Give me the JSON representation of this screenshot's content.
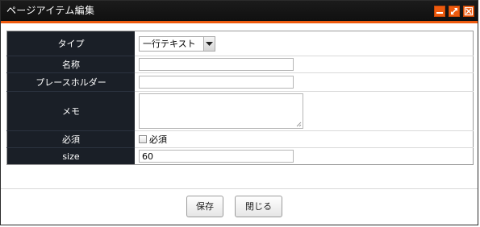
{
  "window": {
    "title": "ページアイテム編集"
  },
  "form": {
    "type": {
      "label": "タイプ",
      "value": "一行テキスト"
    },
    "name": {
      "label": "名称",
      "value": ""
    },
    "placeholder": {
      "label": "プレースホルダー",
      "value": ""
    },
    "memo": {
      "label": "メモ",
      "value": ""
    },
    "required": {
      "label": "必須",
      "checkbox_label": "必須",
      "checked": false
    },
    "size": {
      "label": "size",
      "value": "60"
    }
  },
  "buttons": {
    "save": "保存",
    "close": "閉じる"
  },
  "colors": {
    "titlebar": "#101010",
    "accent": "#ee5a0e",
    "label_bg": "#1a1f27"
  }
}
